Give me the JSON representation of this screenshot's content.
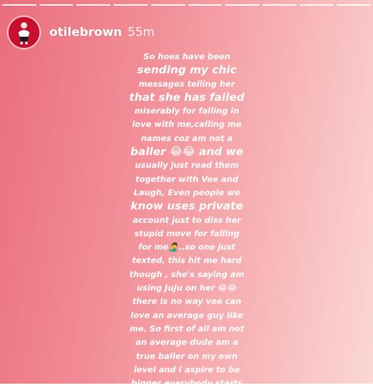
{
  "story": {
    "segments": 10,
    "user": {
      "username": "otilebrown",
      "time_ago": "55m"
    },
    "text_lines": [
      "So hoes have been",
      "sending my chic",
      "messages telling her",
      "that she has failed",
      "miserably for falling in",
      "love with me,calling me",
      "names coz am not a",
      "baller 😂😂 and we",
      "usually just read them",
      "together with Vee and",
      "Laugh, Even people we",
      "know uses private",
      "account just to diss her",
      "stupid move for falling",
      "for me🤦‍♂️..so one just",
      "texted, this hit me hard",
      "though , she's saying am",
      "using JuJu on her 😂😂",
      "there is no way vee can",
      "love an average guy like",
      "me. So first of all am not",
      "an average dude am a",
      "true baller on my own",
      "level and I aspire to be",
      "bigger everybody starts"
    ],
    "colors": {
      "gradient_left": "#ea6e7b",
      "gradient_right": "#fbd7d5",
      "avatar_bg": "#c8102e",
      "text": "#ffffff"
    }
  }
}
